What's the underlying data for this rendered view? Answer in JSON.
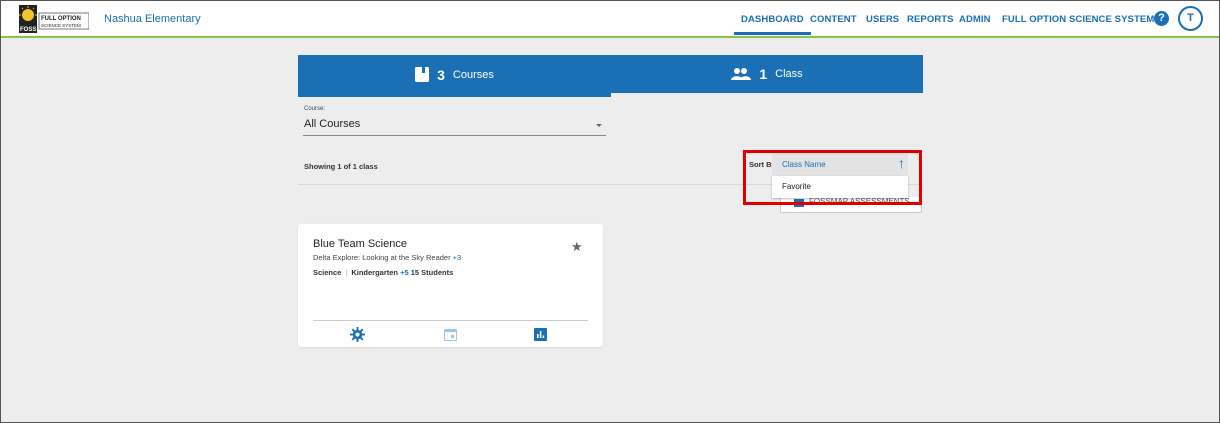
{
  "header": {
    "logo_text_line1": "FULL OPTION",
    "logo_text_line2": "SCIENCE SYSTEM",
    "logo_abbr": "FOSS",
    "school_name": "Nashua Elementary",
    "nav": [
      {
        "label": "DASHBOARD",
        "active": true
      },
      {
        "label": "CONTENT"
      },
      {
        "label": "USERS"
      },
      {
        "label": "REPORTS"
      },
      {
        "label": "ADMIN"
      },
      {
        "label": "FULL OPTION SCIENCE SYSTEM"
      }
    ],
    "help_glyph": "?",
    "avatar_initial": "T"
  },
  "tabs": {
    "courses": {
      "count": "3",
      "label": "Courses",
      "icon": "book-icon"
    },
    "classes": {
      "count": "1",
      "label": "Class",
      "icon": "people-icon"
    }
  },
  "course_filter": {
    "label": "Course:",
    "value": "All Courses"
  },
  "results": {
    "showing": "Showing 1 of 1 class"
  },
  "sort": {
    "label": "Sort By",
    "options": [
      {
        "label": "Class Name",
        "selected": true
      },
      {
        "label": "Favorite"
      }
    ],
    "arrow_glyph": "↑",
    "behind_text": "FOSSMAP ASSESSMENTS"
  },
  "card": {
    "title": "Blue Team Science",
    "subtitle": "Delta Explore: Looking at the Sky Reader",
    "subtitle_more": "+3",
    "subject": "Science",
    "grade": "Kindergarten",
    "grade_more": "+5",
    "students": "15 Students",
    "star_glyph": "★"
  },
  "colors": {
    "brand_blue": "#1a6fb5",
    "header_accent": "#8bc34a",
    "highlight_red": "#e00000"
  }
}
